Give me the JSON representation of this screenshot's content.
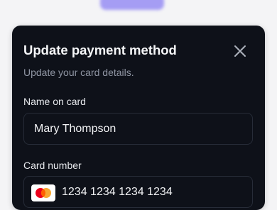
{
  "modal": {
    "title": "Update payment method",
    "subtitle": "Update your card details.",
    "close_icon": "close-icon"
  },
  "form": {
    "name_label": "Name on card",
    "name_value": "Mary Thompson",
    "card_label": "Card number",
    "card_value": "1234 1234 1234 1234",
    "card_brand_icon": "mastercard-icon"
  },
  "colors": {
    "modal_background": "#0e1119",
    "input_border": "#272c38",
    "accent": "#8b80f4",
    "mastercard_red": "#eb001b",
    "mastercard_orange": "#f79e1b"
  }
}
